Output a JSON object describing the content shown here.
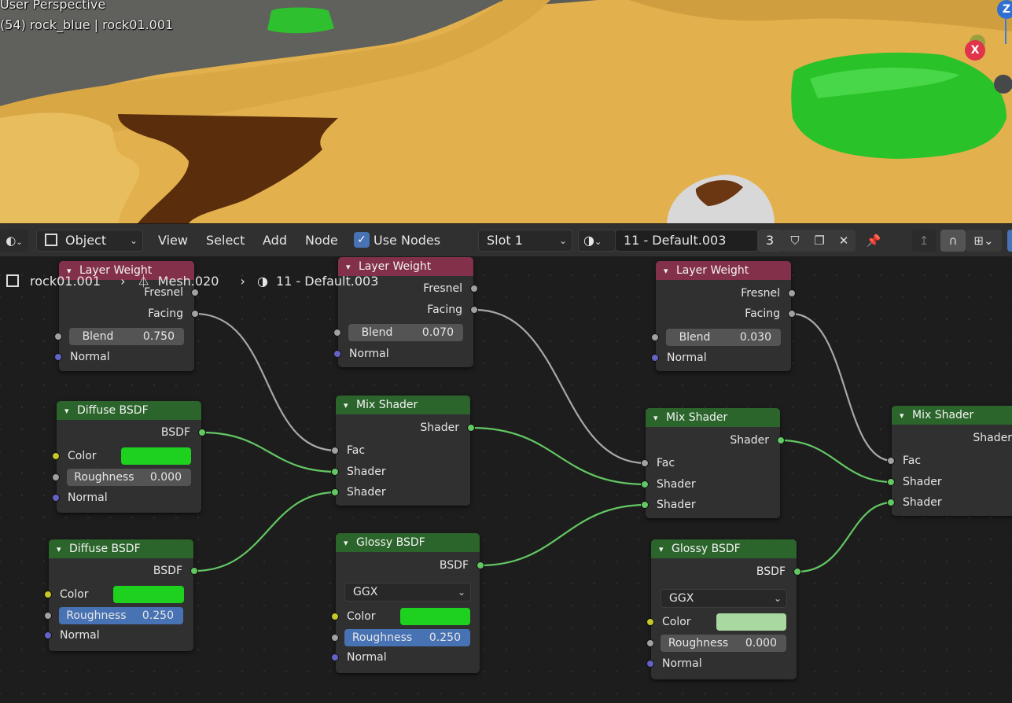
{
  "viewport": {
    "title": "User Perspective",
    "subtitle": "(54) rock_blue | rock01.001",
    "gizmo": {
      "z_label": "Z",
      "x_label": "X"
    }
  },
  "header": {
    "editor_type_icon": "node-editor-icon",
    "mode": "Object",
    "menus": [
      "View",
      "Select",
      "Add",
      "Node"
    ],
    "use_nodes_label": "Use Nodes",
    "use_nodes_checked": true,
    "slot": "Slot 1",
    "material_name": "11 - Default.003",
    "user_count": "3"
  },
  "breadcrumb": {
    "object": "rock01.001",
    "mesh": "Mesh.020",
    "material": "11 - Default.003"
  },
  "nodes": {
    "lw1": {
      "title": "Layer Weight",
      "out1": "Fresnel",
      "out2": "Facing",
      "blend_label": "Blend",
      "blend_value": "0.750",
      "normal": "Normal"
    },
    "lw2": {
      "title": "Layer Weight",
      "out1": "Fresnel",
      "out2": "Facing",
      "blend_label": "Blend",
      "blend_value": "0.070",
      "normal": "Normal"
    },
    "lw3": {
      "title": "Layer Weight",
      "out1": "Fresnel",
      "out2": "Facing",
      "blend_label": "Blend",
      "blend_value": "0.030",
      "normal": "Normal"
    },
    "diff1": {
      "title": "Diffuse BSDF",
      "out": "BSDF",
      "color_label": "Color",
      "color": "#1fd11f",
      "rough_label": "Roughness",
      "rough_value": "0.000",
      "normal": "Normal"
    },
    "diff2": {
      "title": "Diffuse BSDF",
      "out": "BSDF",
      "color_label": "Color",
      "color": "#1fd11f",
      "rough_label": "Roughness",
      "rough_value": "0.250",
      "normal": "Normal"
    },
    "mix1": {
      "title": "Mix Shader",
      "out": "Shader",
      "fac": "Fac",
      "in1": "Shader",
      "in2": "Shader"
    },
    "mix2": {
      "title": "Mix Shader",
      "out": "Shader",
      "fac": "Fac",
      "in1": "Shader",
      "in2": "Shader"
    },
    "mix3": {
      "title": "Mix Shader",
      "out": "Shader",
      "fac": "Fac",
      "in1": "Shader",
      "in2": "Shader"
    },
    "gloss1": {
      "title": "Glossy BSDF",
      "out": "BSDF",
      "distribution": "GGX",
      "color_label": "Color",
      "color": "#1fd11f",
      "rough_label": "Roughness",
      "rough_value": "0.250",
      "normal": "Normal"
    },
    "gloss2": {
      "title": "Glossy BSDF",
      "out": "BSDF",
      "distribution": "GGX",
      "color_label": "Color",
      "color": "#a9d8a0",
      "rough_label": "Roughness",
      "rough_value": "0.000",
      "normal": "Normal"
    }
  },
  "colors": {
    "input_header": "#83314a",
    "shader_header": "#2b652b",
    "shader_socket": "#63c763",
    "value_socket": "#a1a1a1",
    "color_socket": "#c7c729",
    "vector_socket": "#6363c7",
    "accent": "#4772b3"
  }
}
